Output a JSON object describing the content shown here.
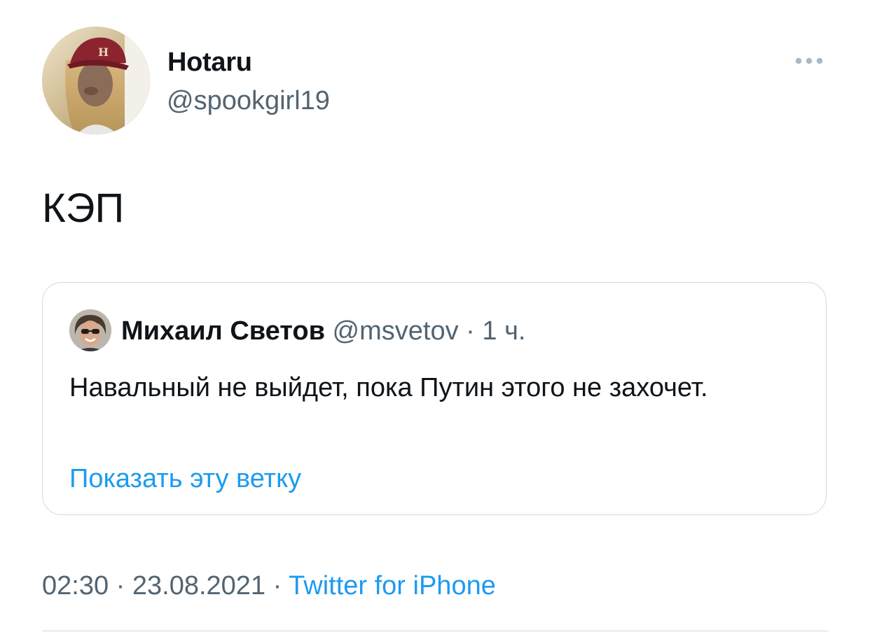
{
  "author": {
    "display_name": "Hotaru",
    "handle": "@spookgirl19"
  },
  "tweet": {
    "text": "КЭП",
    "time": "02:30",
    "separator": " · ",
    "date": "23.08.2021",
    "source": "Twitter for iPhone"
  },
  "quoted_tweet": {
    "author_name": "Михаил Светов",
    "author_handle": "@msvetov",
    "separator": " · ",
    "time_ago": "1 ч.",
    "text": "Навальный не выйдет, пока Путин этого не захочет.",
    "show_thread_label": "Показать эту ветку"
  },
  "icons": {
    "more": "more-horizontal-icon"
  },
  "colors": {
    "text_primary": "#0f1419",
    "text_secondary": "#536471",
    "link": "#1d9bf0",
    "border": "#cfd9de",
    "more_icon": "#aab8c2"
  }
}
